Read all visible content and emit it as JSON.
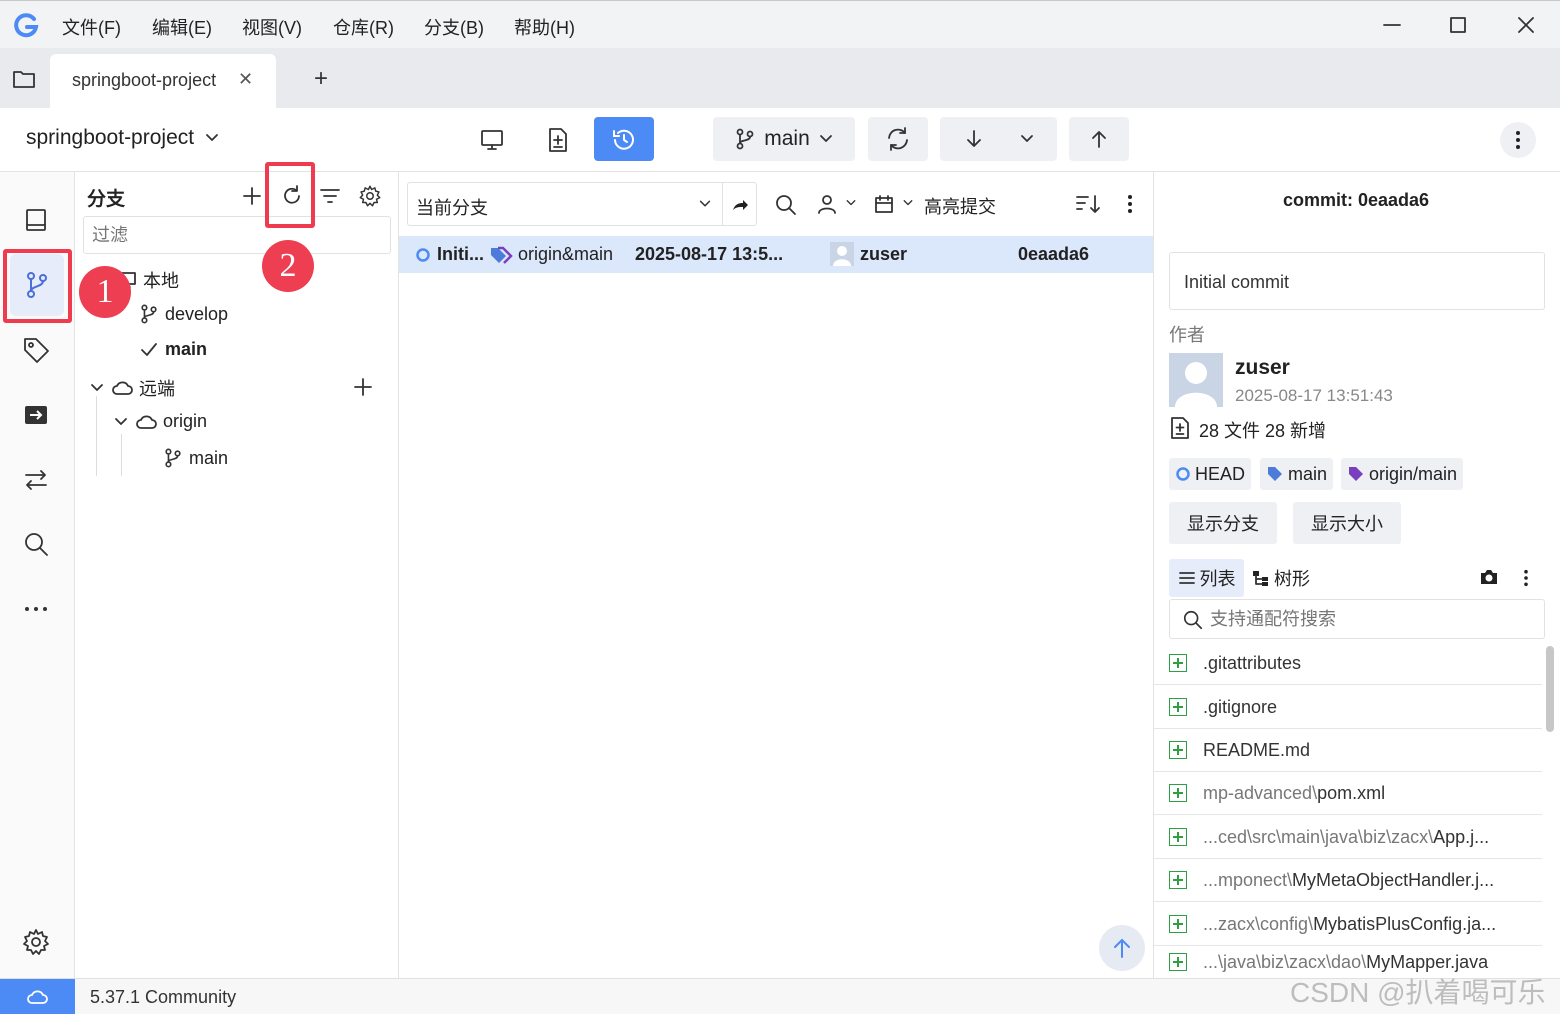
{
  "menubar": {
    "items": [
      "文件(F)",
      "编辑(E)",
      "视图(V)",
      "仓库(R)",
      "分支(B)",
      "帮助(H)"
    ]
  },
  "tabs": [
    {
      "label": "springboot-project",
      "close": "✕"
    }
  ],
  "tab_add": "+",
  "toolbar": {
    "repo_name": "springboot-project",
    "branch": "main"
  },
  "branch_panel": {
    "title": "分支",
    "filter_placeholder": "过滤",
    "local_label": "本地",
    "local_branches": [
      "develop",
      "main"
    ],
    "remote_label": "远端",
    "remote_name": "origin",
    "remote_branches": [
      "main"
    ]
  },
  "commit_filter": {
    "branch_select": "当前分支",
    "highlight": "高亮提交"
  },
  "commits": [
    {
      "message": "Initi...",
      "refs": "origin&main",
      "date": "2025-08-17 13:5...",
      "author": "zuser",
      "hash": "0eaada6"
    }
  ],
  "detail": {
    "title": "commit: 0eaada6",
    "message": "Initial commit",
    "author_label": "作者",
    "author": "zuser",
    "date": "2025-08-17 13:51:43",
    "stats": "28 文件 28 新增",
    "refs": [
      "HEAD",
      "main",
      "origin/main"
    ],
    "show_branch": "显示分支",
    "show_size": "显示大小",
    "view_list": "列表",
    "view_tree": "树形",
    "search_placeholder": "支持通配符搜索",
    "files": [
      {
        "dir": "",
        "name": ".gitattributes"
      },
      {
        "dir": "",
        "name": ".gitignore"
      },
      {
        "dir": "",
        "name": "README.md"
      },
      {
        "dir": "mp-advanced\\",
        "name": "pom.xml"
      },
      {
        "dir": "...ced\\src\\main\\java\\biz\\zacx\\",
        "name": "App.j..."
      },
      {
        "dir": "...mponect\\",
        "name": "MyMetaObjectHandler.j..."
      },
      {
        "dir": "...zacx\\config\\",
        "name": "MybatisPlusConfig.ja..."
      },
      {
        "dir": "...\\java\\biz\\zacx\\dao\\",
        "name": "MyMapper.java"
      }
    ]
  },
  "status": {
    "version": "5.37.1 Community",
    "watermark": "CSDN @扒着喝可乐"
  },
  "annotations": [
    "1",
    "2"
  ],
  "colors": {
    "accent": "#4c8bf5",
    "highlight": "#ef3b50",
    "selected_row": "#dbe7fb",
    "added": "#2ea043"
  }
}
